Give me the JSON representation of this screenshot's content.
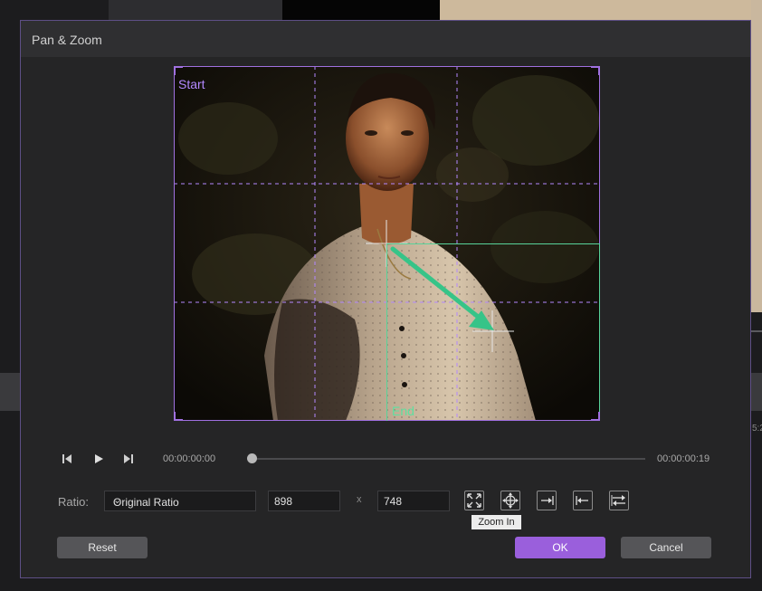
{
  "dialog": {
    "title": "Pan & Zoom"
  },
  "preview": {
    "start_label": "Start",
    "end_label": "End"
  },
  "playback": {
    "current_time": "00:00:00:00",
    "end_time": "00:00:00:19",
    "progress": 0
  },
  "ratio": {
    "label": "Ratio:",
    "selected": "Original Ratio",
    "width": "898",
    "height": "748",
    "separator": "x"
  },
  "tooltip": {
    "text": "Zoom In"
  },
  "buttons": {
    "reset": "Reset",
    "ok": "OK",
    "cancel": "Cancel"
  },
  "background": {
    "ruler_fragment": "5:2"
  },
  "colors": {
    "accent": "#9a5fdc",
    "start_frame": "#a070e0",
    "end_frame": "#58d39a"
  }
}
